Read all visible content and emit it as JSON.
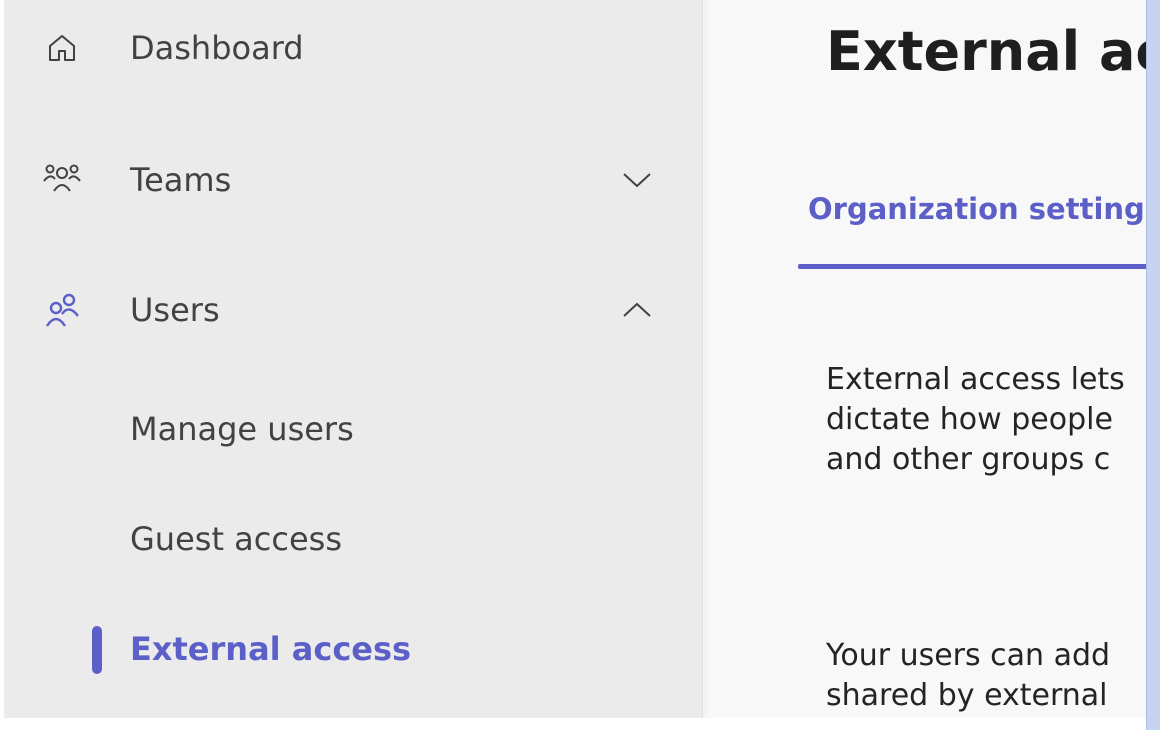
{
  "sidebar": {
    "items": [
      {
        "label": "Dashboard",
        "icon": "home-icon"
      },
      {
        "label": "Teams",
        "icon": "teams-icon",
        "chevron": "chevron-down-icon"
      },
      {
        "label": "Users",
        "icon": "users-icon",
        "chevron": "chevron-up-icon"
      }
    ],
    "subitems": [
      {
        "label": "Manage users"
      },
      {
        "label": "Guest access"
      },
      {
        "label": "External access",
        "active": true
      }
    ]
  },
  "main": {
    "title": "External ac",
    "tab_label": "Organization setting",
    "paragraph1": [
      "External access lets",
      "dictate how people",
      "and other groups c"
    ],
    "paragraph2": [
      "Your users can add",
      "shared by external"
    ]
  },
  "colors": {
    "accent": "#5b5fc7",
    "sidebar_bg": "#ebebeb",
    "main_bg": "#f8f8f8",
    "scrollbar": "#c7d4ef"
  }
}
